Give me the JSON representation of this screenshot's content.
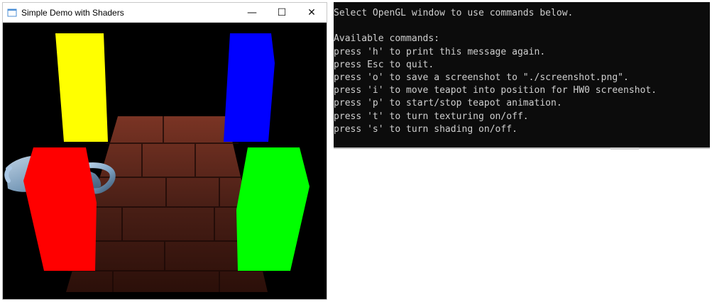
{
  "gl_window": {
    "title": "Simple Demo with Shaders",
    "controls": {
      "minimize": "—",
      "maximize": "☐",
      "close": "✕"
    },
    "pillars": {
      "yellow": "#ffff00",
      "blue": "#0000ff",
      "red": "#ff0000",
      "green": "#00ff00"
    },
    "floor_colors": {
      "base": "#4a1f16",
      "mid": "#5a2519",
      "dark": "#2b0f09",
      "light": "#7a3424"
    },
    "teapot_color": "#7ea2c2"
  },
  "console": {
    "lines": [
      "Select OpenGL window to use commands below.",
      "",
      "Available commands:",
      "press 'h' to print this message again.",
      "press Esc to quit.",
      "press 'o' to save a screenshot to \"./screenshot.png\".",
      "press 'i' to move teapot into position for HW0 screenshot.",
      "press 'p' to start/stop teapot animation.",
      "press 't' to turn texturing on/off.",
      "press 's' to turn shading on/off."
    ]
  }
}
